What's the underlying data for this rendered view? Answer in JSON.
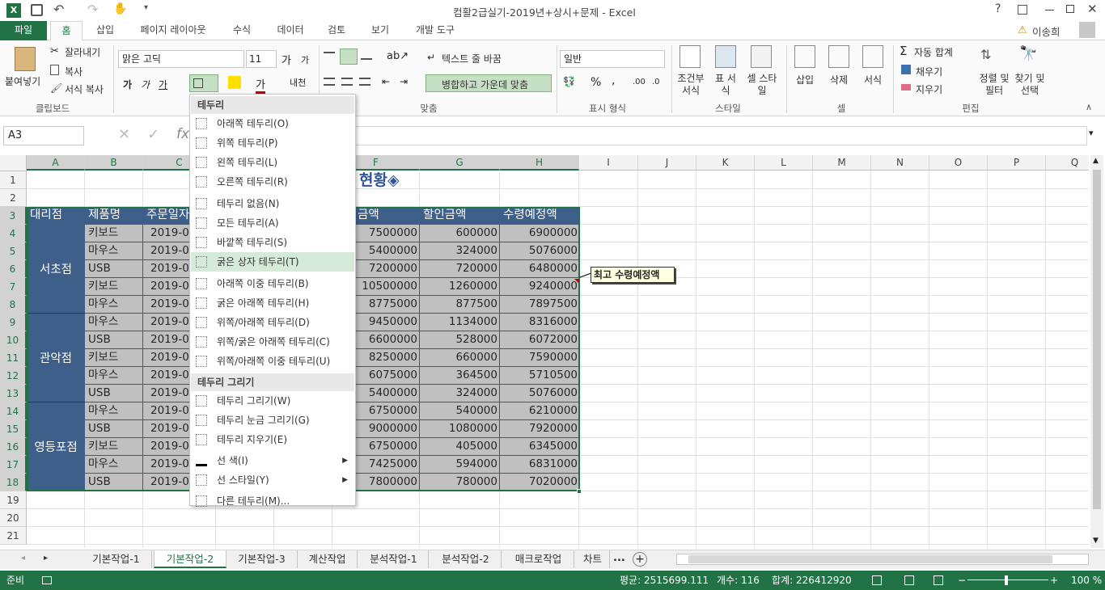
{
  "window": {
    "title": "컴활2급실기-2019년+상시+문제 - Excel",
    "help": "?",
    "user": "이송희"
  },
  "tabs": [
    "파일",
    "홈",
    "삽입",
    "페이지 레이아웃",
    "수식",
    "데이터",
    "검토",
    "보기",
    "개발 도구"
  ],
  "ribbon": {
    "clipboard": {
      "paste": "붙여넣기",
      "cut": "잘라내기",
      "copy": "복사",
      "format_painter": "서식 복사",
      "group": "클립보드"
    },
    "font": {
      "name": "맑은 고딕",
      "size": "11"
    },
    "alignment": {
      "wrap": "텍스트 줄 바꿈",
      "merge": "병합하고 가운데 맞춤",
      "group": "맞춤"
    },
    "number": {
      "format": "일반",
      "group": "표시 형식"
    },
    "styles": {
      "conditional": "조건부 서식",
      "table": "표 서식",
      "cell": "셀 스타일",
      "group": "스타일"
    },
    "cells": {
      "insert": "삽입",
      "delete": "삭제",
      "format": "서식",
      "group": "셀"
    },
    "editing": {
      "autosum": "자동 합계",
      "fill": "채우기",
      "clear": "지우기",
      "sort": "정렬 및 필터",
      "find": "찾기 및 선택",
      "group": "편집"
    }
  },
  "namebox": "A3",
  "columns": [
    "A",
    "B",
    "C",
    "D",
    "E",
    "F",
    "G",
    "H",
    "I",
    "J",
    "K",
    "L",
    "M",
    "N",
    "O",
    "P",
    "Q"
  ],
  "rows": [
    "1",
    "2",
    "3",
    "4",
    "5",
    "6",
    "7",
    "8",
    "9",
    "10",
    "11",
    "12",
    "13",
    "14",
    "15",
    "16",
    "17",
    "18",
    "19",
    "20",
    "21"
  ],
  "sheet": {
    "title_fragment": "현황◈",
    "headers": {
      "a": "대리점",
      "b": "제품명",
      "c": "주문일자",
      "f": "금액",
      "g": "할인금액",
      "h": "수령예정액"
    },
    "branches": [
      "서초점",
      "관악점",
      "영등포점"
    ],
    "products": [
      "키보드",
      "마우스",
      "USB",
      "키보드",
      "마우스",
      "마우스",
      "USB",
      "키보드",
      "마우스",
      "USB",
      "마우스",
      "USB",
      "키보드",
      "마우스",
      "USB"
    ],
    "date_prefix": "2019-0",
    "amount": [
      "7500000",
      "5400000",
      "7200000",
      "10500000",
      "8775000",
      "9450000",
      "6600000",
      "8250000",
      "6075000",
      "5400000",
      "6750000",
      "9000000",
      "6750000",
      "7425000",
      "7800000"
    ],
    "discount": [
      "600000",
      "324000",
      "720000",
      "1260000",
      "877500",
      "1134000",
      "528000",
      "660000",
      "364500",
      "324000",
      "540000",
      "1080000",
      "405000",
      "594000",
      "780000"
    ],
    "receive": [
      "6900000",
      "5076000",
      "6480000",
      "9240000",
      "7897500",
      "8316000",
      "6072000",
      "7590000",
      "5710500",
      "5076000",
      "6210000",
      "7920000",
      "6345000",
      "6831000",
      "7020000"
    ],
    "comment": "최고 수령예정액"
  },
  "border_menu": {
    "header1": "테두리",
    "items1": [
      "아래쪽 테두리(O)",
      "위쪽 테두리(P)",
      "왼쪽 테두리(L)",
      "오른쪽 테두리(R)",
      "테두리 없음(N)",
      "모든 테두리(A)",
      "바깥쪽 테두리(S)",
      "굵은 상자 테두리(T)",
      "아래쪽 이중 테두리(B)",
      "굵은 아래쪽 테두리(H)",
      "위쪽/아래쪽 테두리(D)",
      "위쪽/굵은 아래쪽 테두리(C)",
      "위쪽/아래쪽 이중 테두리(U)"
    ],
    "header2": "테두리 그리기",
    "items2": [
      "테두리 그리기(W)",
      "테두리 눈금 그리기(G)",
      "테두리 지우기(E)",
      "선 색(I)",
      "선 스타일(Y)",
      "다른 테두리(M)..."
    ]
  },
  "sheet_tabs": [
    "기본작업-1",
    "기본작업-2",
    "기본작업-3",
    "계산작업",
    "분석작업-1",
    "분석작업-2",
    "매크로작업",
    "차트"
  ],
  "sheet_tabs_more": "...",
  "status": {
    "ready": "준비",
    "average": "평균: 2515699.111",
    "count": "개수: 116",
    "sum": "합계: 226412920",
    "zoom": "100 %"
  },
  "colors": {
    "excel_green": "#217346",
    "header_fill": "#3e5f8a",
    "data_fill": "#c0c0c0"
  }
}
